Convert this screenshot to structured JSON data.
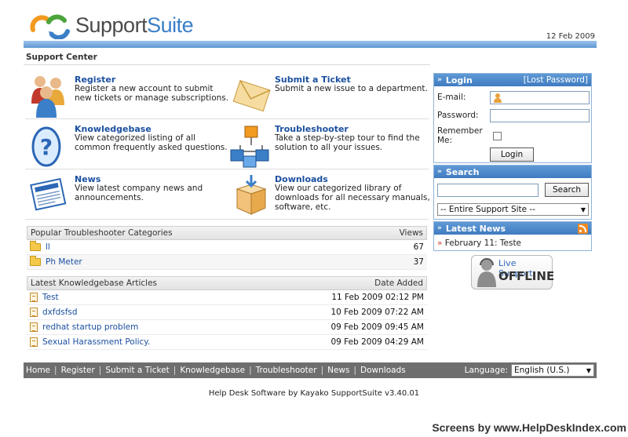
{
  "header": {
    "brand_part1": "Support",
    "brand_part2": "Suite",
    "date": "12 Feb 2009",
    "breadcrumb": "Support Center",
    "brand_color": "#3a7fc8"
  },
  "features": [
    {
      "title": "Register",
      "desc": "Register a new account to submit new tickets or manage subscriptions.",
      "icon": "users-icon"
    },
    {
      "title": "Submit a Ticket",
      "desc": "Submit a new issue to a department.",
      "icon": "envelope-icon"
    },
    {
      "title": "Knowledgebase",
      "desc": "View categorized listing of all common frequently asked questions.",
      "icon": "help-question-icon"
    },
    {
      "title": "Troubleshooter",
      "desc": "Take a step-by-step tour to find the solution to all your issues.",
      "icon": "cubes-tree-icon"
    },
    {
      "title": "News",
      "desc": "View latest company news and announcements.",
      "icon": "newspaper-icon"
    },
    {
      "title": "Downloads",
      "desc": "View our categorized library of downloads for all necessary manuals, software, etc.",
      "icon": "box-download-icon"
    }
  ],
  "troubleshooter": {
    "header": "Popular Troubleshooter Categories",
    "col_views": "Views",
    "rows": [
      {
        "name": "ll",
        "views": "67"
      },
      {
        "name": "Ph Meter",
        "views": "37"
      }
    ]
  },
  "kb": {
    "header": "Latest Knowledgebase Articles",
    "col_date": "Date Added",
    "rows": [
      {
        "title": "Test",
        "date": "11 Feb 2009 02:12 PM"
      },
      {
        "title": "dxfdsfsd",
        "date": "10 Feb 2009 07:22 AM"
      },
      {
        "title": "redhat startup problem",
        "date": "09 Feb 2009 09:45 AM"
      },
      {
        "title": "Sexual Harassment Policy.",
        "date": "09 Feb 2009 04:29 AM"
      }
    ]
  },
  "login": {
    "title": "Login",
    "lost": "[Lost Password]",
    "email_label": "E-mail:",
    "password_label": "Password:",
    "remember_label_1": "Remember",
    "remember_label_2": "Me:",
    "button": "Login"
  },
  "search": {
    "title": "Search",
    "button": "Search",
    "scope": "-- Entire Support Site --"
  },
  "news": {
    "title": "Latest News",
    "items": [
      {
        "bullet": "»",
        "text": "February 11: Teste"
      }
    ]
  },
  "live_support": {
    "line1": "Live Support",
    "line2": "OFFLINE"
  },
  "footer": {
    "nav": [
      "Home",
      "Register",
      "Submit a Ticket",
      "Knowledgebase",
      "Troubleshooter",
      "News",
      "Downloads"
    ],
    "language_label": "Language:",
    "language_value": "English (U.S.)",
    "powered": "Help Desk Software by Kayako SupportSuite v3.40.01"
  },
  "watermark": "Screens by www.HelpDeskIndex.com"
}
